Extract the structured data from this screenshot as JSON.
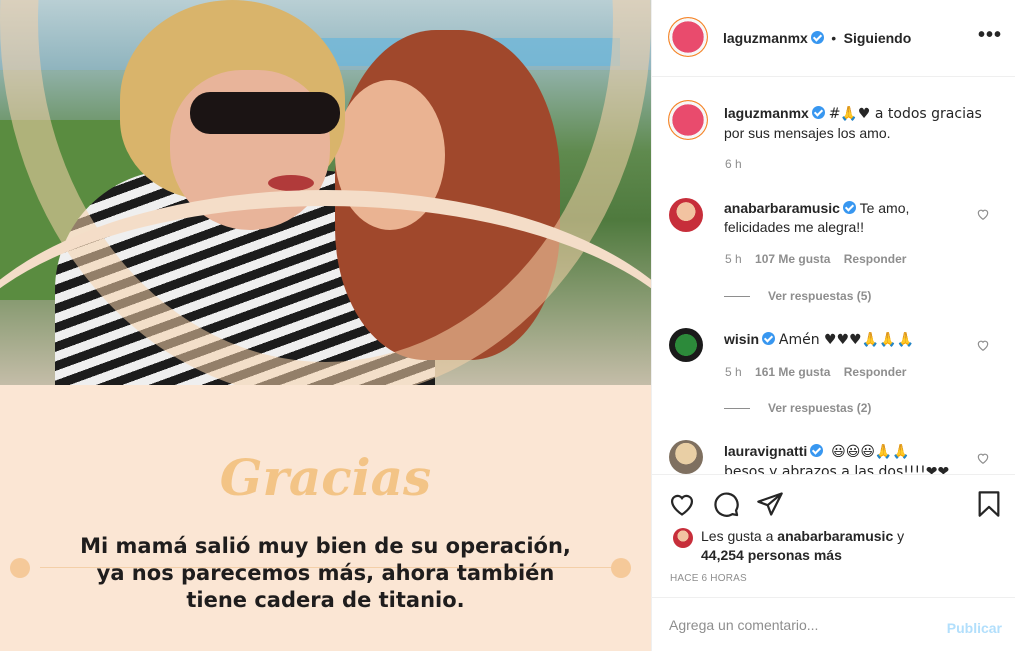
{
  "post_image": {
    "heading": "Gracias",
    "message_lines": [
      "Mi mamá salió muy bien de su operación,",
      "ya nos parecemos más, ahora también",
      "tiene cadera de titanio."
    ]
  },
  "header": {
    "username": "laguzmanmx",
    "separator": "•",
    "follow_status": "Siguiendo",
    "more_label": "•••"
  },
  "caption": {
    "username": "laguzmanmx",
    "text_line1": "#🙏♥ a todos gracias",
    "text_line2": "por sus mensajes los amo.",
    "time": "6 h"
  },
  "comments": [
    {
      "username": "anabarbaramusic",
      "text_line1": "Te amo,",
      "text_line2": "felicidades me alegra!!",
      "time": "5 h",
      "likes": "107 Me gusta",
      "reply_label": "Responder",
      "view_replies": "Ver respuestas (5)"
    },
    {
      "username": "wisin",
      "text_line1": "Amén ♥♥♥🙏🙏🙏",
      "time": "5 h",
      "likes": "161 Me gusta",
      "reply_label": "Responder",
      "view_replies": "Ver respuestas (2)"
    },
    {
      "username": "lauravignatti",
      "text_line1": "😃😃😃🙏🙏",
      "text_line2": "besos y abrazos a las dos!!!!❤❤"
    }
  ],
  "actions": {
    "icons": [
      "heart-icon",
      "comment-icon",
      "share-icon",
      "bookmark-icon"
    ]
  },
  "likes": {
    "prefix": "Les gusta a",
    "first_user": "anabarbaramusic",
    "connector": "y",
    "count_text": "44,254 personas más"
  },
  "timestamp": "HACE 6 HORAS",
  "comment_box": {
    "placeholder": "Agrega un comentario...",
    "publish_label": "Publicar"
  },
  "colors": {
    "verified": "#3897f0",
    "publish_disabled": "#b2dffc",
    "gracias_text": "#f3c486",
    "card_background": "#fbe6d4"
  }
}
